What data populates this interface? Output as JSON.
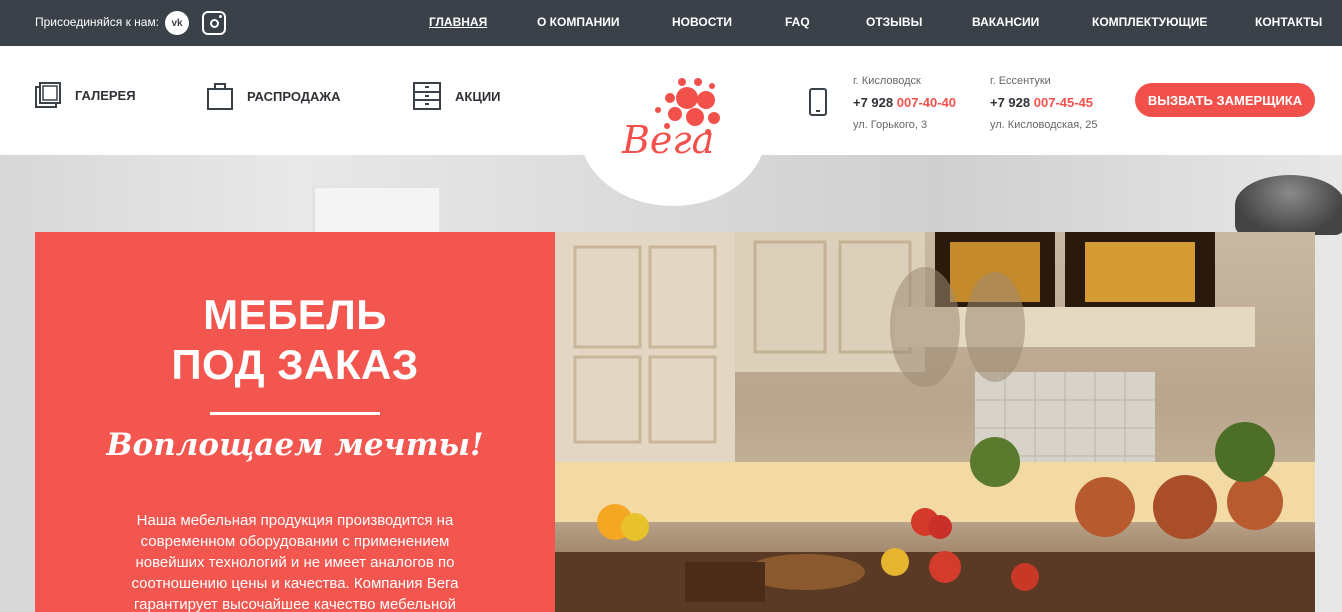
{
  "topbar": {
    "join_label": "Присоединяйся к нам:",
    "social": [
      {
        "name": "vk-icon",
        "label": "vk"
      },
      {
        "name": "instagram-icon",
        "label": ""
      }
    ],
    "nav": [
      {
        "label": "ГЛАВНАЯ",
        "active": true
      },
      {
        "label": "О КОМПАНИИ"
      },
      {
        "label": "НОВОСТИ"
      },
      {
        "label": "FAQ"
      },
      {
        "label": "ОТЗЫВЫ"
      },
      {
        "label": "ВАКАНСИИ"
      },
      {
        "label": "КОМПЛЕКТУЮЩИЕ"
      },
      {
        "label": "КОНТАКТЫ"
      }
    ]
  },
  "header": {
    "links": [
      {
        "label": "ГАЛЕРЕЯ",
        "icon": "gallery-icon"
      },
      {
        "label": "РАСПРОДАЖА",
        "icon": "bag-icon"
      },
      {
        "label": "АКЦИИ",
        "icon": "drawers-icon"
      }
    ],
    "logo_text": "Вега",
    "contacts": [
      {
        "city": "г. Кисловодск",
        "phone_prefix": "+7 928 ",
        "phone_rest": "007-40-40",
        "address": "ул. Горького, 3"
      },
      {
        "city": "г. Ессентуки",
        "phone_prefix": "+7 928 ",
        "phone_rest": "007-45-45",
        "address": "ул. Кисловодская, 25"
      }
    ],
    "cta_label": "ВЫЗВАТЬ ЗАМЕРЩИКА"
  },
  "hero": {
    "title_line1": "МЕБЕЛЬ",
    "title_line2": "ПОД ЗАКАЗ",
    "slogan": "Воплощаем мечты!",
    "description": "Наша мебельная продукция производится на современном оборудовании с применением новейших технологий и не имеет аналогов по соотношению цены и качества. Компания Вега гарантирует высочайшее качество мебельной"
  },
  "colors": {
    "accent": "#f2514b",
    "topbar": "#3b4148",
    "text_dark": "#2f3338"
  }
}
